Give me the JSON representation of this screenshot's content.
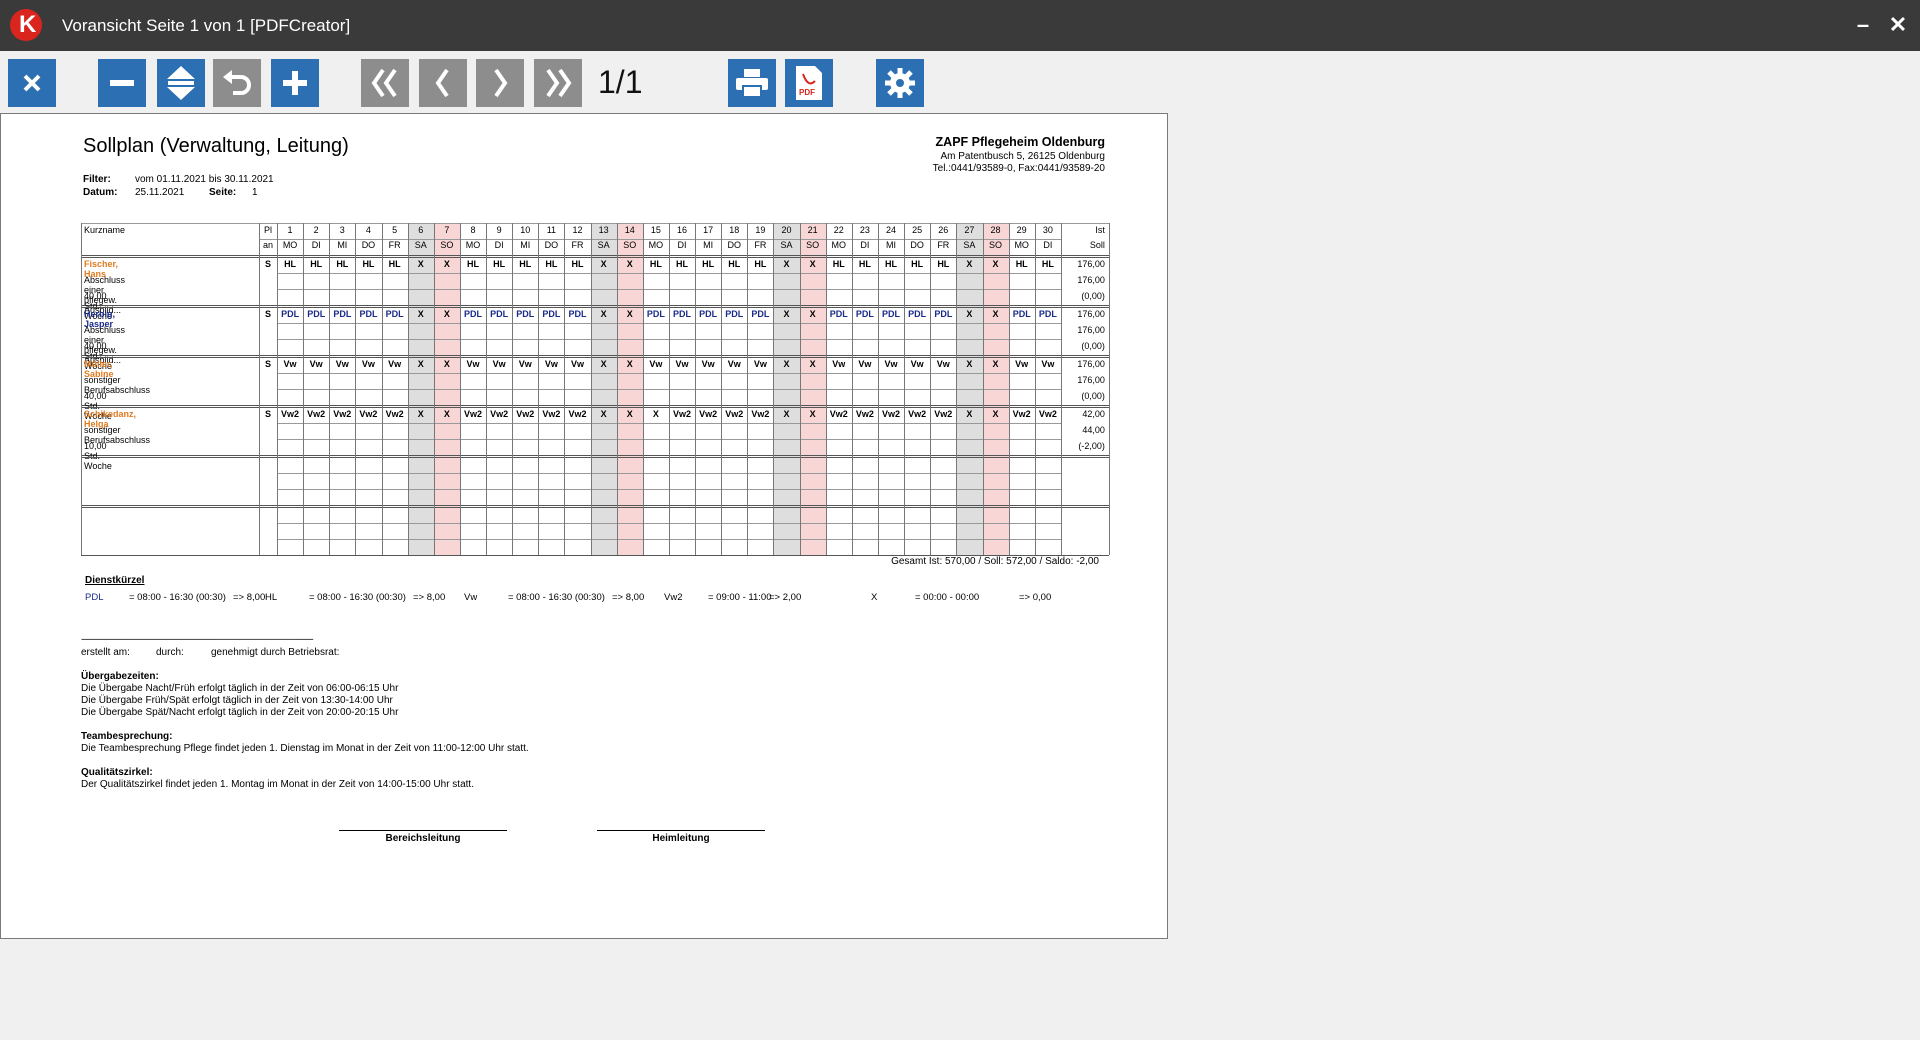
{
  "window": {
    "title": "Voransicht Seite 1 von 1 [PDFCreator]",
    "logo_letter": "K",
    "minimize": "–",
    "close": "✕"
  },
  "toolbar": {
    "page_label": "1/1",
    "colors": {
      "active": "#2c6fb3",
      "disabled": "#8d8d8d",
      "pdf": "#d9251d"
    },
    "icons": [
      "close-icon",
      "zoom-out-icon",
      "fit-height-icon",
      "undo-icon",
      "zoom-in-icon",
      "first-page-icon",
      "prev-page-icon",
      "next-page-icon",
      "last-page-icon",
      "print-icon",
      "pdf-icon",
      "settings-icon"
    ]
  },
  "doc": {
    "title": "Sollplan (Verwaltung, Leitung)",
    "filter_label": "Filter:",
    "filter_value": "vom 01.11.2021 bis 30.11.2021",
    "date_label": "Datum:",
    "date_value": "25.11.2021",
    "page_label": "Seite:",
    "page_value": "1",
    "org_name": "ZAPF Pflegeheim Oldenburg",
    "org_address": "Am Patentbusch 5, 26125 Oldenburg",
    "org_phone": "Tel.:0441/93589-0, Fax:0441/93589-20",
    "col_name": "Kurzname",
    "col_pl1": "Pl",
    "col_pl2": "an",
    "col_ist": "Ist",
    "col_soll": "Soll",
    "days": [
      "1",
      "2",
      "3",
      "4",
      "5",
      "6",
      "7",
      "8",
      "9",
      "10",
      "11",
      "12",
      "13",
      "14",
      "15",
      "16",
      "17",
      "18",
      "19",
      "20",
      "21",
      "22",
      "23",
      "24",
      "25",
      "26",
      "27",
      "28",
      "29",
      "30"
    ],
    "weekdays": [
      "MO",
      "DI",
      "MI",
      "DO",
      "FR",
      "SA",
      "SO",
      "MO",
      "DI",
      "MI",
      "DO",
      "FR",
      "SA",
      "SO",
      "MO",
      "DI",
      "MI",
      "DO",
      "FR",
      "SA",
      "SO",
      "MO",
      "DI",
      "MI",
      "DO",
      "FR",
      "SA",
      "SO",
      "MO",
      "DI"
    ],
    "employees": [
      {
        "name": "Fischer, Hans",
        "color": "#e07b1f",
        "qual": "Abschluss einer pflegew. Ausbild...",
        "hours": "40,00 Std. Woche",
        "pl": "S",
        "shifts": [
          "HL",
          "HL",
          "HL",
          "HL",
          "HL",
          "X",
          "X",
          "HL",
          "HL",
          "HL",
          "HL",
          "HL",
          "X",
          "X",
          "HL",
          "HL",
          "HL",
          "HL",
          "HL",
          "X",
          "X",
          "HL",
          "HL",
          "HL",
          "HL",
          "HL",
          "X",
          "X",
          "HL",
          "HL"
        ],
        "shift_color": "#000000",
        "ist": "176,00",
        "soll": "176,00",
        "saldo": "(0,00)"
      },
      {
        "name": "Herbig, Jasper",
        "color": "#1a2a8a",
        "qual": "Abschluss einer pflegew. Ausbild...",
        "hours": "40,00 Std. Woche",
        "pl": "S",
        "shifts": [
          "PDL",
          "PDL",
          "PDL",
          "PDL",
          "PDL",
          "X",
          "X",
          "PDL",
          "PDL",
          "PDL",
          "PDL",
          "PDL",
          "X",
          "X",
          "PDL",
          "PDL",
          "PDL",
          "PDL",
          "PDL",
          "X",
          "X",
          "PDL",
          "PDL",
          "PDL",
          "PDL",
          "PDL",
          "X",
          "X",
          "PDL",
          "PDL"
        ],
        "shift_color": "#1a2a8a",
        "ist": "176,00",
        "soll": "176,00",
        "saldo": "(0,00)"
      },
      {
        "name": "Müller, Sabine",
        "color": "#e07b1f",
        "qual": "sonstiger Berufsabschluss",
        "hours": "40,00 Std. Woche",
        "pl": "S",
        "shifts": [
          "Vw",
          "Vw",
          "Vw",
          "Vw",
          "Vw",
          "X",
          "X",
          "Vw",
          "Vw",
          "Vw",
          "Vw",
          "Vw",
          "X",
          "X",
          "Vw",
          "Vw",
          "Vw",
          "Vw",
          "Vw",
          "X",
          "X",
          "Vw",
          "Vw",
          "Vw",
          "Vw",
          "Vw",
          "X",
          "X",
          "Vw",
          "Vw"
        ],
        "shift_color": "#000000",
        "ist": "176,00",
        "soll": "176,00",
        "saldo": "(0,00)"
      },
      {
        "name": "Schikedanz, Helga",
        "color": "#e07b1f",
        "qual": "sonstiger Berufsabschluss",
        "hours": "10,00 Std. Woche",
        "pl": "S",
        "shifts": [
          "Vw2",
          "Vw2",
          "Vw2",
          "Vw2",
          "Vw2",
          "X",
          "X",
          "Vw2",
          "Vw2",
          "Vw2",
          "Vw2",
          "Vw2",
          "X",
          "X",
          "X",
          "Vw2",
          "Vw2",
          "Vw2",
          "Vw2",
          "X",
          "X",
          "Vw2",
          "Vw2",
          "Vw2",
          "Vw2",
          "Vw2",
          "X",
          "X",
          "Vw2",
          "Vw2"
        ],
        "shift_color": "#000000",
        "ist": "42,00",
        "soll": "44,00",
        "saldo": "(-2,00)"
      }
    ],
    "totals": "Gesamt Ist: 570,00 / Soll: 572,00 / Saldo: -2,00",
    "legend_title": "Dienstkürzel",
    "legend": [
      {
        "code": "PDL",
        "def": "= 08:00 - 16:30 (00:30)",
        "val": "=> 8,00"
      },
      {
        "code": "HL",
        "def": "= 08:00 - 16:30 (00:30)",
        "val": "=> 8,00"
      },
      {
        "code": "Vw",
        "def": "= 08:00 - 16:30 (00:30)",
        "val": "=> 8,00"
      },
      {
        "code": "Vw2",
        "def": "= 09:00 - 11:00",
        "val": "=> 2,00"
      },
      {
        "code": "X",
        "def": "= 00:00 - 00:00",
        "val": "=> 0,00"
      }
    ],
    "dashes": "--------------------------------------------------------------------------------------------------------------------",
    "created_at": "erstellt am:",
    "by": "durch:",
    "approved": "genehmigt durch Betriebsrat:",
    "handover_title": "Übergabezeiten:",
    "handover_1": "Die Übergabe Nacht/Früh erfolgt täglich in der Zeit von 06:00-06:15 Uhr",
    "handover_2": "Die Übergabe Früh/Spät erfolgt täglich in der Zeit von 13:30-14:00 Uhr",
    "handover_3": "Die Übergabe Spät/Nacht erfolgt täglich in der Zeit von 20:00-20:15 Uhr",
    "team_title": "Teambesprechung:",
    "team_text": "Die Teambesprechung Pflege findet jeden 1. Dienstag im Monat in der Zeit von 11:00-12:00 Uhr statt.",
    "quality_title": "Qualitätszirkel:",
    "quality_text": "Der Qualitätszirkel findet jeden 1. Montag im Monat in der Zeit von 14:00-15:00 Uhr statt.",
    "sign_1": "Bereichsleitung",
    "sign_2": "Heimleitung"
  }
}
